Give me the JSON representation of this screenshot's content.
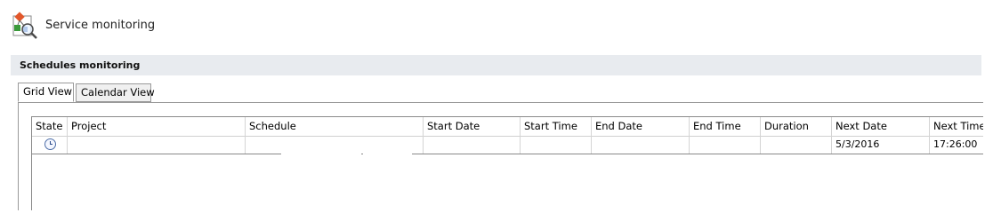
{
  "app": {
    "title": "Service monitoring",
    "icon": "service-monitoring-icon"
  },
  "section": {
    "title": "Schedules monitoring"
  },
  "tabs": [
    {
      "label": "Grid View",
      "active": true
    },
    {
      "label": "Calendar View",
      "active": false
    }
  ],
  "grid": {
    "columns": [
      "State",
      "Project",
      "Schedule",
      "Start Date",
      "Start Time",
      "End Date",
      "End Time",
      "Duration",
      "Next Date",
      "Next Time"
    ],
    "rows": [
      {
        "state_icon": "clock-icon",
        "project": "",
        "schedule": "",
        "start_date": "",
        "start_time": "",
        "end_date": "",
        "end_time": "",
        "duration": "",
        "next_date": "5/3/2016",
        "next_time": "17:26:00"
      }
    ]
  }
}
